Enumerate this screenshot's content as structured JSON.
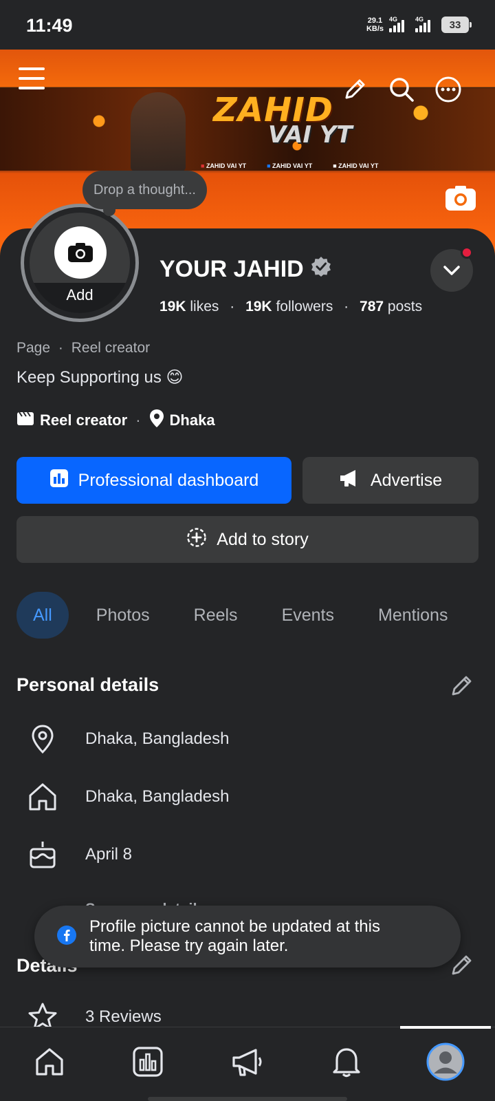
{
  "status_bar": {
    "time": "11:49",
    "net_speed_top": "29.1",
    "net_speed_bottom": "KB/s",
    "sim1": "4G",
    "sim2": "4G",
    "battery": "33"
  },
  "cover": {
    "title": "ZAHID",
    "subtitle": "VAI YT",
    "socials": [
      "ZAHID VAI YT",
      "ZAHID VAI YT",
      "ZAHID VAI YT"
    ]
  },
  "thought_bubble": "Drop a thought...",
  "avatar": {
    "add_label": "Add"
  },
  "profile": {
    "name": "YOUR JAHID",
    "likes_count": "19K",
    "likes_label": "likes",
    "followers_count": "19K",
    "followers_label": "followers",
    "posts_count": "787",
    "posts_label": "posts",
    "dot": "·",
    "meta_type": "Page",
    "meta_category": "Reel creator",
    "bio": "Keep Supporting us 😊",
    "tag_category": "Reel creator",
    "tag_location": "Dhaka"
  },
  "buttons": {
    "professional_dashboard": "Professional dashboard",
    "advertise": "Advertise",
    "add_to_story": "Add to story"
  },
  "tabs": [
    {
      "label": "All"
    },
    {
      "label": "Photos"
    },
    {
      "label": "Reels"
    },
    {
      "label": "Events"
    },
    {
      "label": "Mentions"
    }
  ],
  "personal_details": {
    "title": "Personal details",
    "rows": [
      {
        "icon": "location-pin-icon",
        "text": "Dhaka, Bangladesh"
      },
      {
        "icon": "home-icon",
        "text": "Dhaka, Bangladesh"
      },
      {
        "icon": "birthday-cake-icon",
        "text": "April 8"
      }
    ],
    "see_more": "See more details"
  },
  "details": {
    "title": "Details",
    "rows": [
      {
        "icon": "star-icon",
        "text": "3 Reviews"
      }
    ]
  },
  "toast": {
    "text_line1": "Profile picture cannot be updated at this",
    "text_line2": "time. Please try again later."
  },
  "colors": {
    "accent": "#0866ff",
    "background": "#242527",
    "surface": "#3a3b3c",
    "notification": "#e41e3f"
  }
}
